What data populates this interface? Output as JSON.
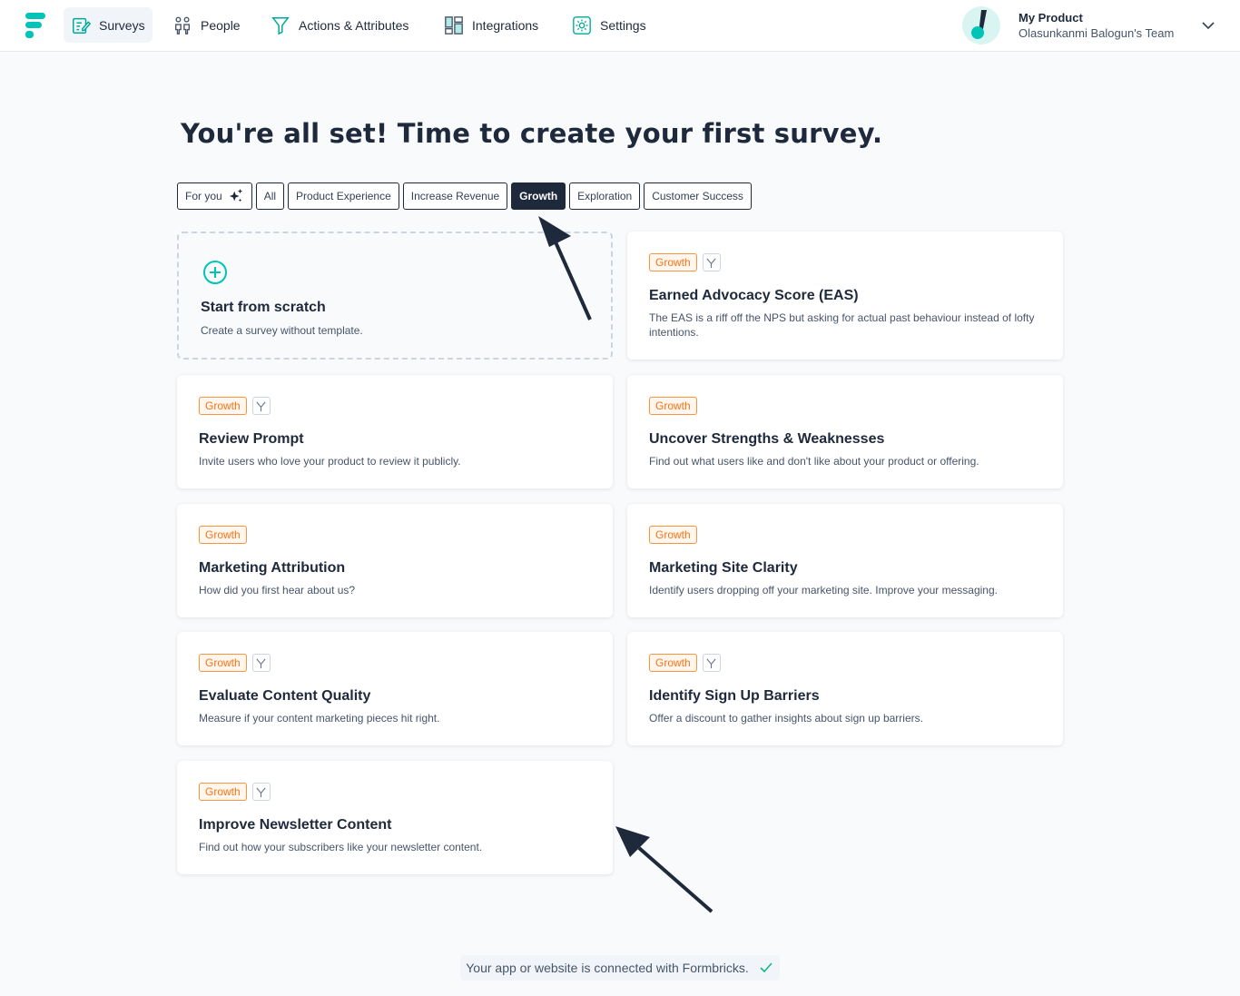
{
  "nav": {
    "items": [
      {
        "label": "Surveys"
      },
      {
        "label": "People"
      },
      {
        "label": "Actions & Attributes"
      },
      {
        "label": "Integrations"
      },
      {
        "label": "Settings"
      }
    ],
    "profile": {
      "product": "My Product",
      "team": "Olasunkanmi Balogun's Team"
    }
  },
  "page": {
    "title": "You're all set! Time to create your first survey."
  },
  "filters": [
    {
      "label": "For you"
    },
    {
      "label": "All"
    },
    {
      "label": "Product Experience"
    },
    {
      "label": "Increase Revenue"
    },
    {
      "label": "Growth",
      "active": true
    },
    {
      "label": "Exploration"
    },
    {
      "label": "Customer Success"
    }
  ],
  "scratch": {
    "title": "Start from scratch",
    "description": "Create a survey without template."
  },
  "templates": [
    {
      "tag": "Growth",
      "branching": true,
      "title": "Earned Advocacy Score (EAS)",
      "description": "The EAS is a riff off the NPS but asking for actual past behaviour instead of lofty intentions."
    },
    {
      "tag": "Growth",
      "branching": true,
      "title": "Review Prompt",
      "description": "Invite users who love your product to review it publicly."
    },
    {
      "tag": "Growth",
      "branching": false,
      "title": "Uncover Strengths & Weaknesses",
      "description": "Find out what users like and don't like about your product or offering."
    },
    {
      "tag": "Growth",
      "branching": false,
      "title": "Marketing Attribution",
      "description": "How did you first hear about us?"
    },
    {
      "tag": "Growth",
      "branching": false,
      "title": "Marketing Site Clarity",
      "description": "Identify users dropping off your marketing site. Improve your messaging."
    },
    {
      "tag": "Growth",
      "branching": true,
      "title": "Evaluate Content Quality",
      "description": "Measure if your content marketing pieces hit right."
    },
    {
      "tag": "Growth",
      "branching": true,
      "title": "Identify Sign Up Barriers",
      "description": "Offer a discount to gather insights about sign up barriers."
    },
    {
      "tag": "Growth",
      "branching": true,
      "title": "Improve Newsletter Content",
      "description": "Find out how your subscribers like your newsletter content."
    }
  ],
  "footer": {
    "connected": "Your app or website is connected with Formbricks."
  },
  "colors": {
    "brand": "#00c4b8",
    "dark": "#1e293b",
    "tag_orange": "#f97316"
  }
}
